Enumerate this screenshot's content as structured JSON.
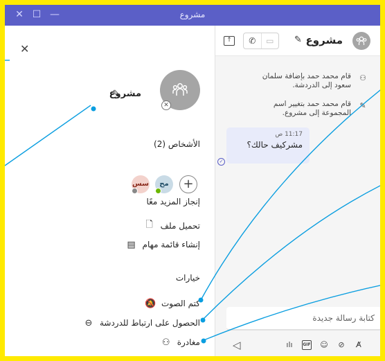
{
  "window": {
    "title": "مشروع",
    "buttons": {
      "close": "✕",
      "maximize": "☐",
      "minimize": "—"
    }
  },
  "details": {
    "close": "✕",
    "group_name": "مشروع",
    "edit_icon": "pencil-icon",
    "people_header": "الأشخاص (2)",
    "add_person": "+",
    "people": [
      {
        "initials": "مح",
        "status": "available"
      },
      {
        "initials": "سس",
        "status": "offline"
      }
    ],
    "more_header": "إنجاز المزيد معًا",
    "more_actions": [
      {
        "label": "تحميل ملف",
        "icon": "upload-file-icon"
      },
      {
        "label": "إنشاء قائمة مهام",
        "icon": "task-list-icon"
      }
    ],
    "options_header": "خيارات",
    "options": [
      {
        "label": "كتم الصوت",
        "icon": "mute-bell-icon"
      },
      {
        "label": "الحصول على ارتباط للدردشة",
        "icon": "link-icon"
      },
      {
        "label": "مغادرة",
        "icon": "leave-icon"
      }
    ]
  },
  "chat": {
    "title": "مشروع",
    "system_messages": [
      "قام محمد حمد بإضافة سلمان سعود إلى الدردشة.",
      "قام محمد حمد بتغيير اسم المجموعة إلى مشروع."
    ],
    "message": {
      "time": "11:17 ص",
      "text": "مشركيف حالك؟"
    },
    "compose_placeholder": "كتابة رسالة جديدة",
    "gif_label": "GIF"
  },
  "colors": {
    "brand": "#5b5fc7",
    "highlight": "#ffea00",
    "callout": "#00a3e0"
  }
}
